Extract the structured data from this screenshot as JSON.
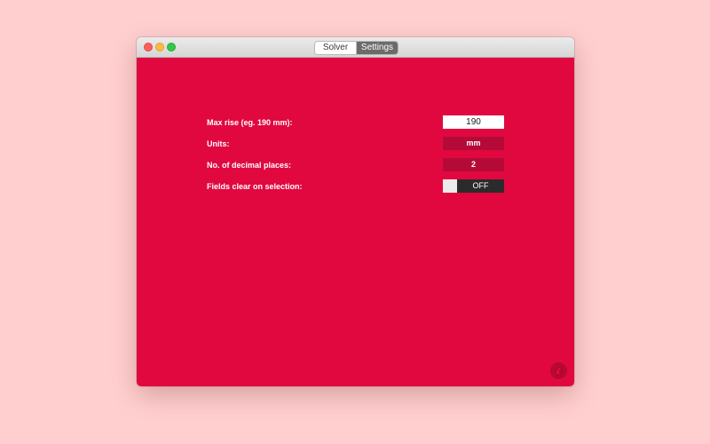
{
  "tabs": {
    "solver": "Solver",
    "settings": "Settings",
    "active": "Settings"
  },
  "settings": {
    "max_rise": {
      "label": "Max rise (eg. 190 mm):",
      "value": "190"
    },
    "units": {
      "label": "Units:",
      "value": "mm"
    },
    "decimal_places": {
      "label": "No. of decimal places:",
      "value": "2"
    },
    "fields_clear": {
      "label": "Fields clear on selection:",
      "value": "OFF"
    }
  },
  "icons": {
    "badge": "logo-badge-icon"
  },
  "colors": {
    "background": "#ffcfcf",
    "accent": "#e10840",
    "field_dark": "#b50a37",
    "toggle_dark": "#2b2b2b"
  }
}
